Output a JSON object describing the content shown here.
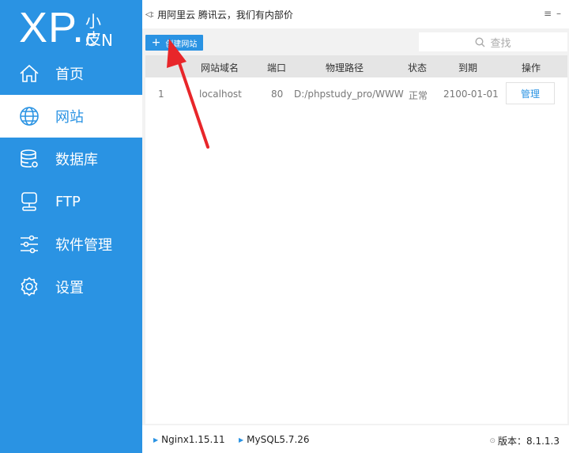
{
  "logo": {
    "main": "XP.",
    "sub_top": "小皮",
    "sub_bottom": "CN"
  },
  "sidebar": {
    "items": [
      {
        "label": "首页",
        "icon": "home-icon",
        "active": false
      },
      {
        "label": "网站",
        "icon": "globe-icon",
        "active": true
      },
      {
        "label": "数据库",
        "icon": "database-icon",
        "active": false
      },
      {
        "label": "FTP",
        "icon": "server-icon",
        "active": false
      },
      {
        "label": "软件管理",
        "icon": "sliders-icon",
        "active": false
      },
      {
        "label": "设置",
        "icon": "gear-icon",
        "active": false
      }
    ]
  },
  "topbar": {
    "notice": "用阿里云 腾讯云，我们有内部价"
  },
  "toolbar": {
    "create_label": "创建网站",
    "search_placeholder": "查找"
  },
  "table": {
    "headers": [
      "网站域名",
      "端口",
      "物理路径",
      "状态",
      "到期",
      "操作"
    ],
    "rows": [
      {
        "index": "1",
        "domain": "localhost",
        "port": "80",
        "path": "D:/phpstudy_pro/WWW",
        "status": "正常",
        "expire": "2100-01-01",
        "action": "管理"
      }
    ]
  },
  "statusbar": {
    "nginx": "Nginx1.15.11",
    "mysql": "MySQL5.7.26",
    "version": "版本：8.1.1.3"
  },
  "colors": {
    "accent": "#2a93e3",
    "annotation_arrow": "#e8262a"
  }
}
